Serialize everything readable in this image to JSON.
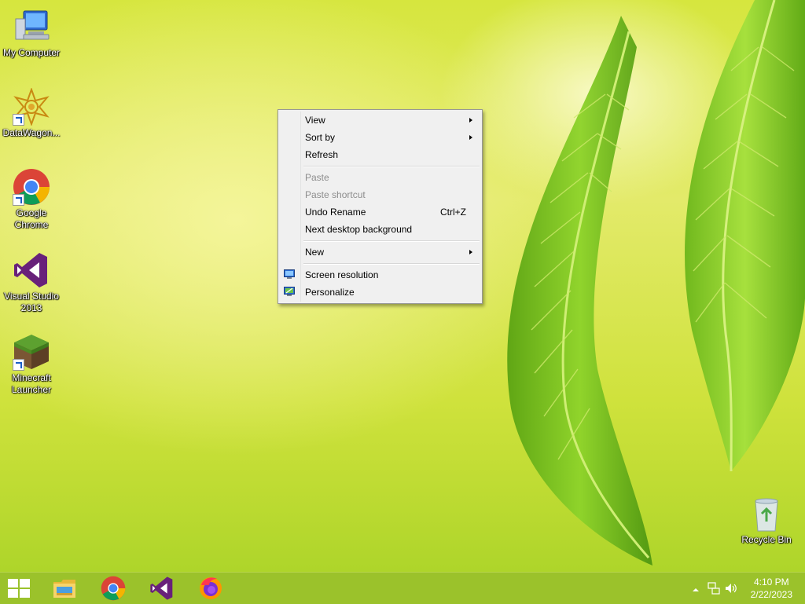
{
  "desktop": {
    "icons": [
      {
        "label": "My Computer"
      },
      {
        "label": "DataWagon..."
      },
      {
        "label": "Google\nChrome"
      },
      {
        "label": "Visual Studio\n2013"
      },
      {
        "label": "Minecraft\nLauncher"
      },
      {
        "label": "Recycle Bin"
      }
    ]
  },
  "context_menu": {
    "items": [
      {
        "label": "View"
      },
      {
        "label": "Sort by"
      },
      {
        "label": "Refresh"
      },
      {
        "label": "Paste"
      },
      {
        "label": "Paste shortcut"
      },
      {
        "label": "Undo Rename",
        "accelerator": "Ctrl+Z"
      },
      {
        "label": "Next desktop background"
      },
      {
        "label": "New"
      },
      {
        "label": "Screen resolution"
      },
      {
        "label": "Personalize"
      }
    ]
  },
  "taskbar": {
    "pinned": [
      "start-icon",
      "file-explorer-icon",
      "chrome-icon",
      "visual-studio-icon",
      "firefox-icon"
    ],
    "clock": {
      "time": "4:10 PM",
      "date": "2/22/2023"
    }
  },
  "colors": {
    "taskbar": "#9bc22b",
    "menu_bg": "#f0f0f0",
    "disabled_text": "#8d8d8d",
    "leaf_green": "#7cc11e"
  }
}
